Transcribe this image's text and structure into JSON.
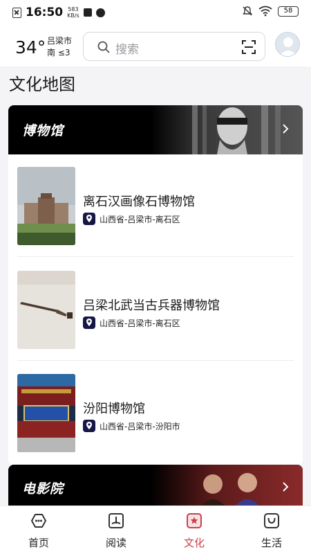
{
  "status": {
    "time": "16:50",
    "net_speed_value": "583",
    "net_speed_unit": "KB/s",
    "battery": "58"
  },
  "header": {
    "temperature": "34°",
    "city": "吕梁市",
    "wind": "南 ≤3",
    "search_placeholder": "搜索"
  },
  "page": {
    "title": "文化地图"
  },
  "museum_section": {
    "title": "博物馆",
    "items": [
      {
        "name": "离石汉画像石博物馆",
        "location": "山西省-吕梁市-离石区"
      },
      {
        "name": "吕梁北武当古兵器博物馆",
        "location": "山西省-吕梁市-离石区"
      },
      {
        "name": "汾阳博物馆",
        "location": "山西省-吕梁市-汾阳市"
      }
    ]
  },
  "cinema_section": {
    "title": "电影院"
  },
  "bottom_nav": {
    "items": [
      {
        "label": "首页",
        "icon": "home-icon"
      },
      {
        "label": "阅读",
        "icon": "book-icon"
      },
      {
        "label": "文化",
        "icon": "culture-star-icon",
        "active": true
      },
      {
        "label": "生活",
        "icon": "life-bag-icon"
      }
    ],
    "active_color": "#c8424a"
  }
}
